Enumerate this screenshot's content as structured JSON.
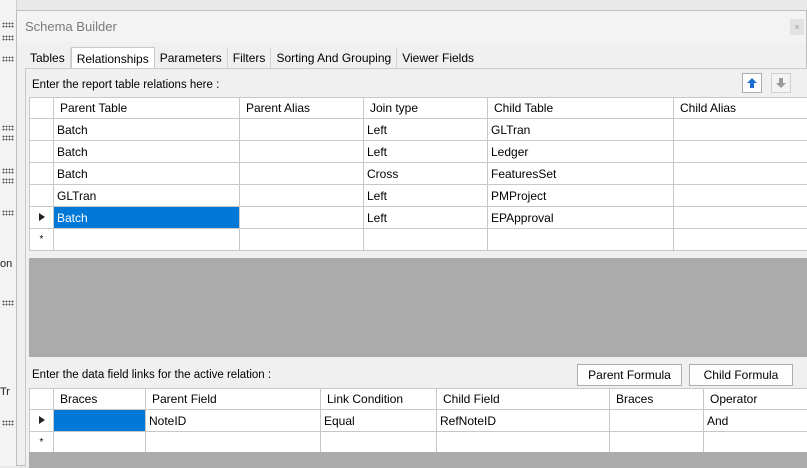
{
  "window": {
    "title": "Schema Builder",
    "close_glyph": "×"
  },
  "background": {
    "fragment_1": "on",
    "fragment_2": "Tr"
  },
  "tabs": [
    {
      "label": "Tables"
    },
    {
      "label": "Relationships"
    },
    {
      "label": "Parameters"
    },
    {
      "label": "Filters"
    },
    {
      "label": "Sorting And Grouping"
    },
    {
      "label": "Viewer Fields"
    }
  ],
  "active_tab": "Relationships",
  "relations": {
    "label": "Enter the report table relations here :",
    "columns": [
      "Parent Table",
      "Parent Alias",
      "Join type",
      "Child Table",
      "Child Alias"
    ],
    "rows": [
      {
        "parent_table": "Batch",
        "parent_alias": "",
        "join_type": "Left",
        "child_table": "GLTran",
        "child_alias": ""
      },
      {
        "parent_table": "Batch",
        "parent_alias": "",
        "join_type": "Left",
        "child_table": "Ledger",
        "child_alias": ""
      },
      {
        "parent_table": "Batch",
        "parent_alias": "",
        "join_type": "Cross",
        "child_table": "FeaturesSet",
        "child_alias": ""
      },
      {
        "parent_table": "GLTran",
        "parent_alias": "",
        "join_type": "Left",
        "child_table": "PMProject",
        "child_alias": ""
      },
      {
        "parent_table": "Batch",
        "parent_alias": "",
        "join_type": "Left",
        "child_table": "EPApproval",
        "child_alias": ""
      }
    ],
    "new_row_glyph": "*"
  },
  "links": {
    "label": "Enter the data field links for the active relation :",
    "parent_formula_label": "Parent Formula",
    "child_formula_label": "Child Formula",
    "columns": [
      "Braces",
      "Parent Field",
      "Link Condition",
      "Child Field",
      "Braces",
      "Operator"
    ],
    "rows": [
      {
        "braces_open": "",
        "parent_field": "NoteID",
        "link_condition": "Equal",
        "child_field": "RefNoteID",
        "braces_close": "",
        "operator": "And"
      }
    ],
    "new_row_glyph": "*"
  },
  "colors": {
    "selection": "#0078d7",
    "grid_empty": "#ababab",
    "arrow_up": "#1c6fd1",
    "arrow_down": "#9a9a9a"
  },
  "icons": {
    "move_up": "arrow-up-icon",
    "move_down": "arrow-down-icon",
    "current_row": "triangle-right-icon"
  }
}
